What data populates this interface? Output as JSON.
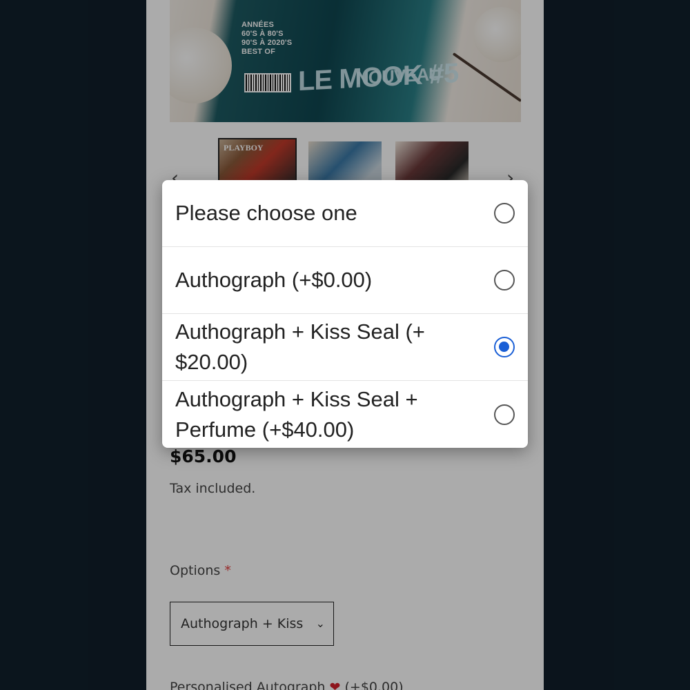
{
  "page": {
    "hero_image": {
      "magazine_text": "ANNÉES\n60'S À 80'S\n90'S À 2020'S\nBEST OF",
      "magazine_title": "LE MOOK #5",
      "magazine_banner": "NOUVEAU"
    },
    "thumbnails": [
      {
        "label": "PLAYBOY"
      },
      {
        "label": ""
      },
      {
        "label": ""
      }
    ],
    "gallery_prev": "‹",
    "gallery_next": "›",
    "price": "$65.00",
    "tax_note": "Tax included.",
    "options_label": "Options",
    "required_marker": "*",
    "options_select_value": "Authograph + Kiss",
    "personalised_label": "Personalised Autograph",
    "personalised_price": "(+$0.00)"
  },
  "dialog": {
    "options": [
      {
        "label": "Please choose one",
        "selected": false
      },
      {
        "label": "Authograph (+$0.00)",
        "selected": false
      },
      {
        "label": "Authograph + Kiss Seal (+ $20.00)",
        "selected": true
      },
      {
        "label": "Authograph + Kiss Seal + Perfume (+$40.00)",
        "selected": false
      }
    ]
  },
  "colors": {
    "background": "#111f2b",
    "accent": "#1a5fd6",
    "required": "#e23b3b"
  }
}
